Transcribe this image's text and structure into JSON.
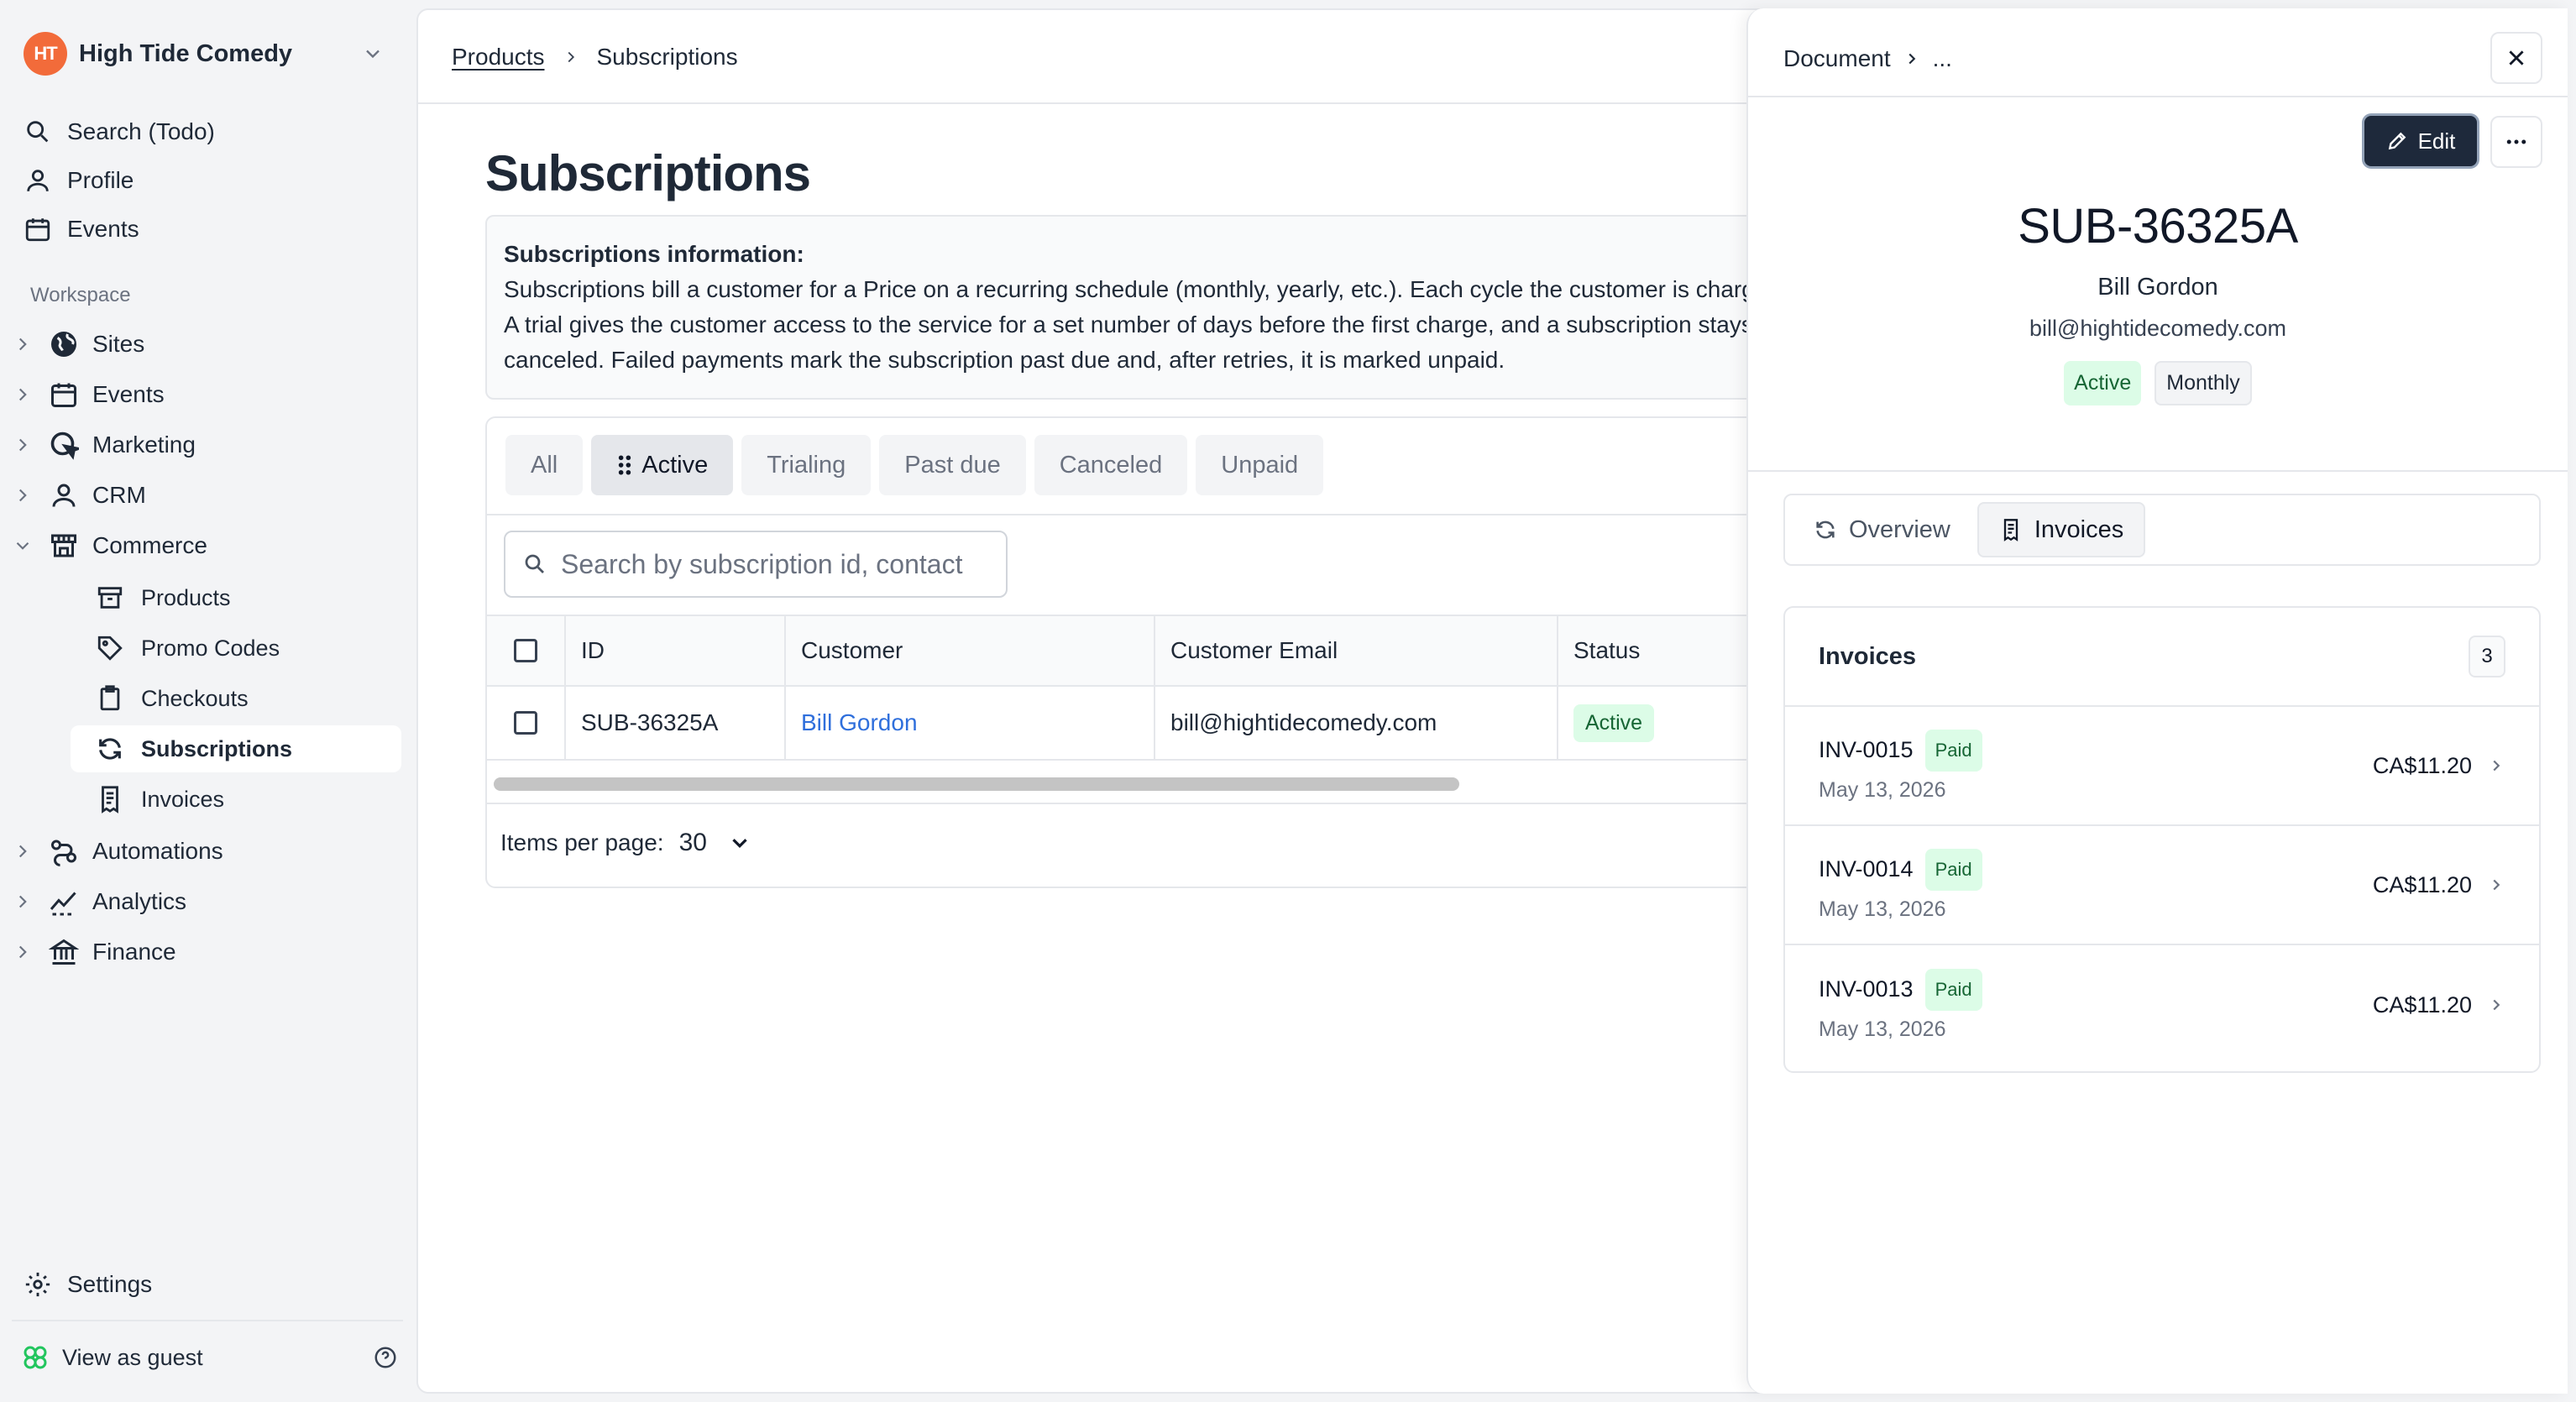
{
  "org": {
    "name": "High Tide Comedy",
    "logo_text": "HT"
  },
  "nav_top": [
    {
      "label": "Search (Todo)",
      "icon": "search-icon"
    },
    {
      "label": "Profile",
      "icon": "user-icon"
    },
    {
      "label": "Events",
      "icon": "calendar-icon"
    }
  ],
  "workspace": {
    "label": "Workspace",
    "items": [
      {
        "label": "Sites",
        "icon": "globe-icon"
      },
      {
        "label": "Events",
        "icon": "calendar-icon"
      },
      {
        "label": "Marketing",
        "icon": "megaphone-icon"
      },
      {
        "label": "CRM",
        "icon": "user-icon"
      },
      {
        "label": "Commerce",
        "icon": "store-icon"
      }
    ],
    "commerce_children": [
      {
        "label": "Products",
        "icon": "archive-icon"
      },
      {
        "label": "Promo Codes",
        "icon": "tag-icon"
      },
      {
        "label": "Checkouts",
        "icon": "clipboard-icon"
      },
      {
        "label": "Subscriptions",
        "icon": "refresh-icon",
        "active": true
      },
      {
        "label": "Invoices",
        "icon": "receipt-icon"
      }
    ],
    "after": [
      {
        "label": "Automations",
        "icon": "automation-icon"
      },
      {
        "label": "Analytics",
        "icon": "analytics-icon"
      },
      {
        "label": "Finance",
        "icon": "bank-icon"
      }
    ]
  },
  "footer": {
    "settings": "Settings",
    "guest": "View as guest"
  },
  "breadcrumb": {
    "parent": "Products",
    "current": "Subscriptions"
  },
  "page": {
    "title": "Subscriptions",
    "info_title": "Subscriptions information:",
    "info_body": "Subscriptions bill a customer for a Price on a recurring schedule (monthly, yearly, etc.). Each cycle the customer is charged automatically. A trial gives the customer access to the service for a set number of days before the first charge, and a subscription stays active until it is canceled. Failed payments mark the subscription past due and, after retries, it is marked unpaid."
  },
  "filters": [
    {
      "label": "All"
    },
    {
      "label": "Active",
      "selected": true
    },
    {
      "label": "Trialing"
    },
    {
      "label": "Past due"
    },
    {
      "label": "Canceled"
    },
    {
      "label": "Unpaid"
    }
  ],
  "search": {
    "placeholder": "Search by subscription id, contact"
  },
  "table": {
    "columns": [
      "ID",
      "Customer",
      "Customer Email",
      "Status"
    ],
    "rows": [
      {
        "id": "SUB-36325A",
        "customer": "Bill Gordon",
        "email": "bill@hightidecomedy.com",
        "status": "Active"
      }
    ]
  },
  "pager": {
    "label": "Items per page:",
    "value": "30"
  },
  "panel": {
    "crumb_root": "Document",
    "crumb_more": "...",
    "edit_label": "Edit",
    "title": "SUB-36325A",
    "name": "Bill Gordon",
    "email": "bill@hightidecomedy.com",
    "badges": [
      "Active",
      "Monthly"
    ],
    "tabs": [
      {
        "label": "Overview",
        "icon": "refresh-icon"
      },
      {
        "label": "Invoices",
        "icon": "receipt-icon",
        "selected": true
      }
    ],
    "invoices_title": "Invoices",
    "invoices_count": "3",
    "invoices": [
      {
        "number": "INV-0015",
        "status": "Paid",
        "date": "May 13, 2026",
        "amount": "CA$11.20"
      },
      {
        "number": "INV-0014",
        "status": "Paid",
        "date": "May 13, 2026",
        "amount": "CA$11.20"
      },
      {
        "number": "INV-0013",
        "status": "Paid",
        "date": "May 13, 2026",
        "amount": "CA$11.20"
      }
    ]
  },
  "colors": {
    "accent": "#1e293b",
    "link": "#2f6fdc",
    "success_bg": "#dcfce7",
    "success_text": "#166534",
    "logo": "#f26b3a"
  }
}
